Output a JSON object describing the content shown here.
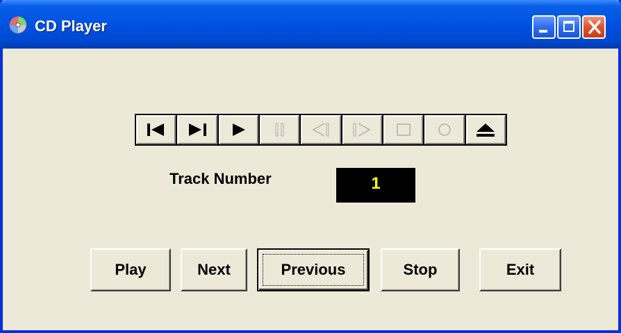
{
  "window": {
    "title": "CD Player",
    "icons": {
      "app": "cd-disc-icon",
      "minimize": "minimize-icon",
      "maximize": "maximize-icon",
      "close": "close-icon"
    }
  },
  "mci_toolbar": {
    "buttons": [
      {
        "name": "prev-track-button",
        "icon": "skip-back-icon",
        "enabled": true
      },
      {
        "name": "next-track-button",
        "icon": "skip-forward-icon",
        "enabled": true
      },
      {
        "name": "play-button",
        "icon": "play-icon",
        "enabled": true
      },
      {
        "name": "pause-button",
        "icon": "pause-icon",
        "enabled": false
      },
      {
        "name": "rewind-button",
        "icon": "rewind-icon",
        "enabled": false
      },
      {
        "name": "fast-forward-button",
        "icon": "fast-forward-icon",
        "enabled": false
      },
      {
        "name": "stop-button",
        "icon": "stop-icon",
        "enabled": false
      },
      {
        "name": "record-button",
        "icon": "record-icon",
        "enabled": false
      },
      {
        "name": "eject-button",
        "icon": "eject-icon",
        "enabled": true
      }
    ]
  },
  "track": {
    "label": "Track Number",
    "value": "1"
  },
  "buttons": {
    "play": "Play",
    "next": "Next",
    "previous": "Previous",
    "stop": "Stop",
    "exit": "Exit"
  },
  "colors": {
    "titlebar": "#0054e3",
    "window_bg": "#ece9d8",
    "display_bg": "#000000",
    "display_text": "#ffff00",
    "disabled_glyph": "#a0a0a0"
  }
}
